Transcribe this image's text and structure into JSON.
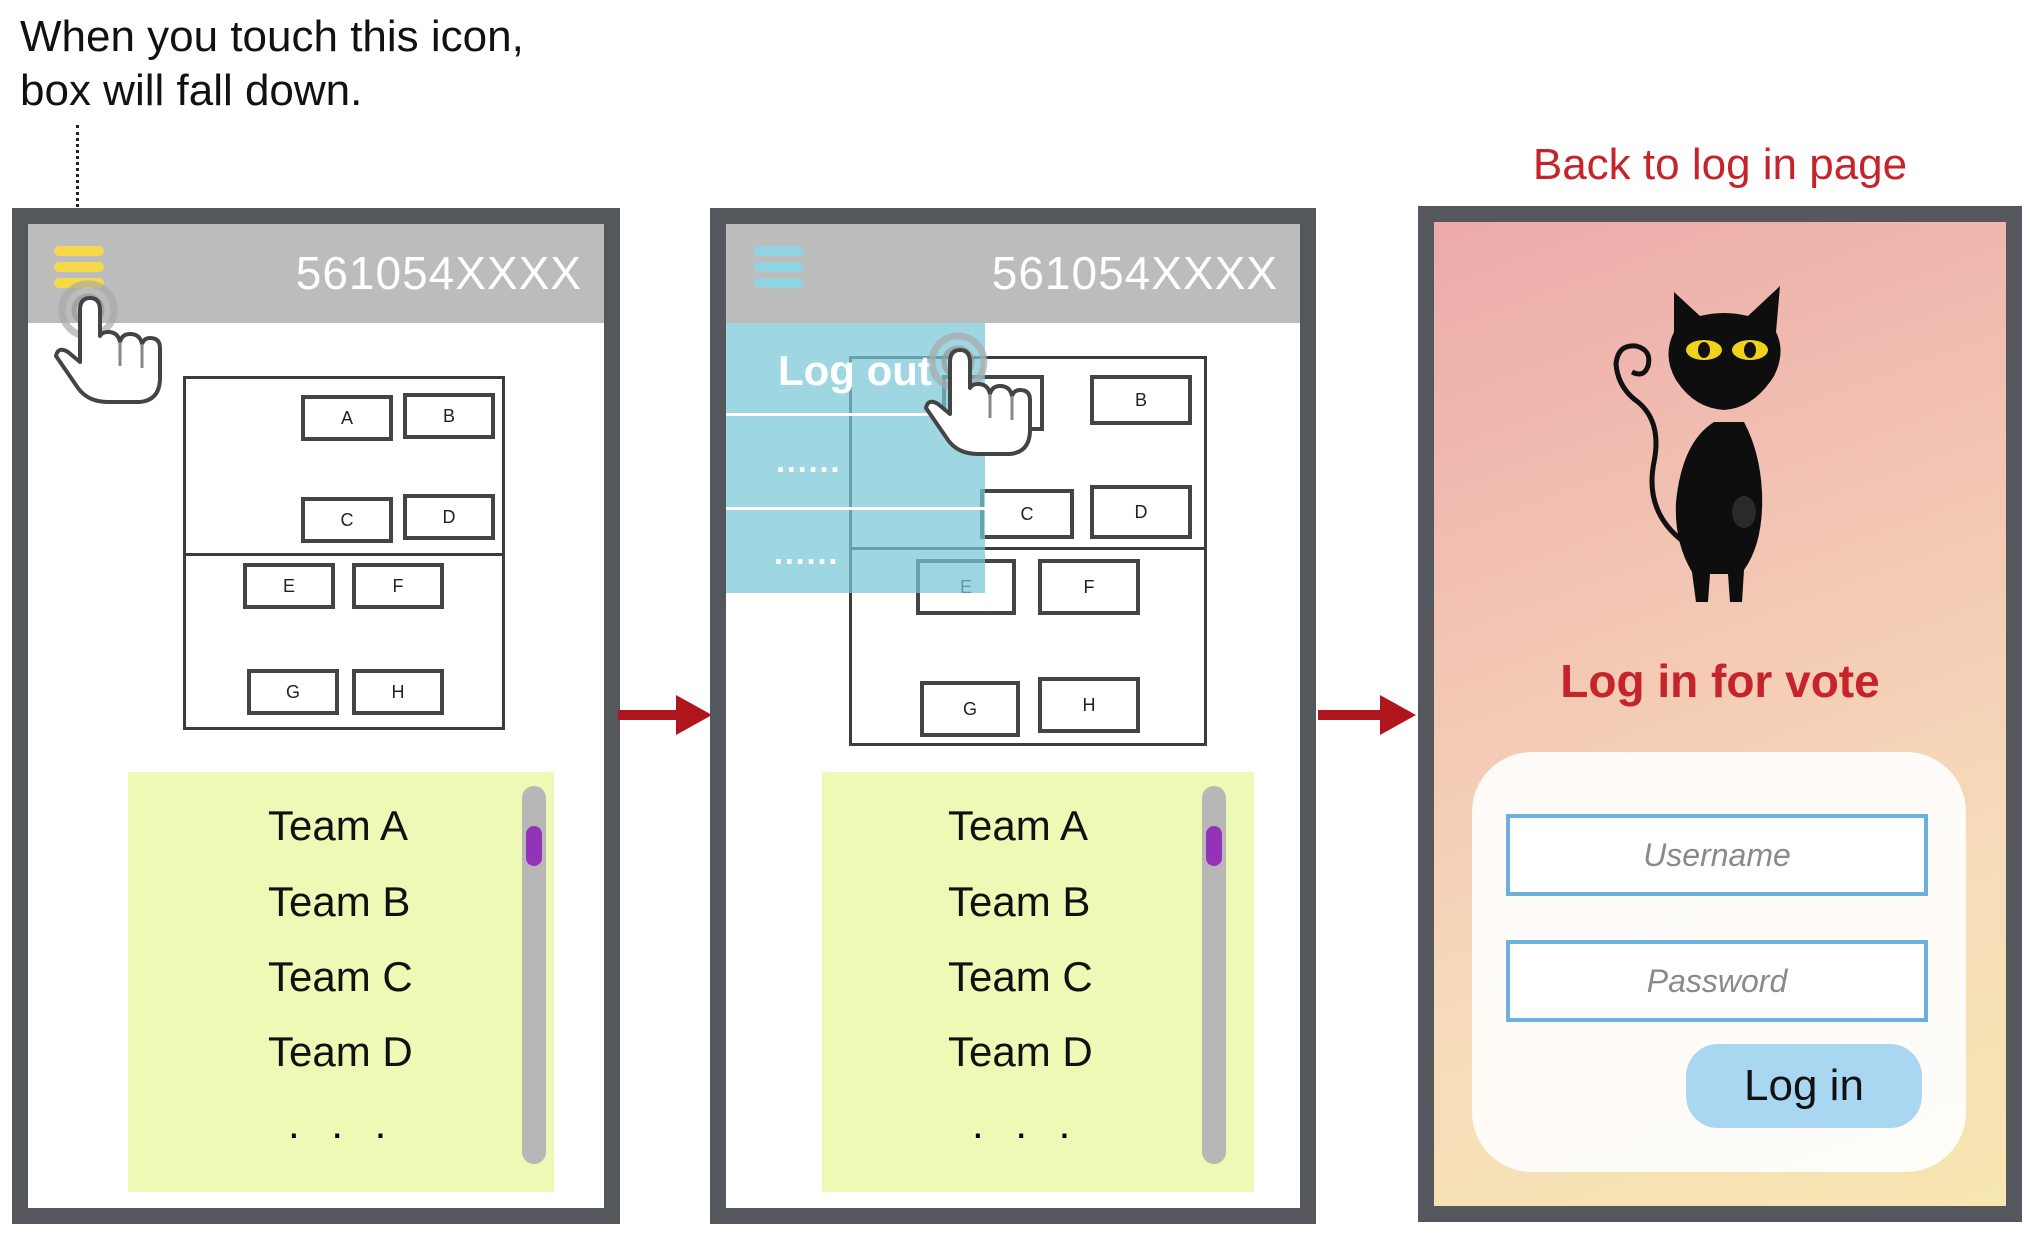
{
  "annotation": {
    "line1": "When you touch this icon,",
    "line2": "box will fall down."
  },
  "login_header": "Back to log in page",
  "screen1": {
    "phone_number": "561054XXXX",
    "menu_icon": "hamburger-menu-icon",
    "seats": [
      "A",
      "B",
      "C",
      "D",
      "E",
      "F",
      "G",
      "H"
    ],
    "teams": [
      "Team A",
      "Team B",
      "Team C",
      "Team D"
    ],
    "more": ". . ."
  },
  "screen2": {
    "phone_number": "561054XXXX",
    "menu_icon": "hamburger-menu-icon",
    "dropdown": {
      "logout": "Log out",
      "item2": "......",
      "item3": "......"
    },
    "seats": [
      "A",
      "B",
      "C",
      "D",
      "E",
      "F",
      "G",
      "H"
    ],
    "teams": [
      "Team A",
      "Team B",
      "Team C",
      "Team D"
    ],
    "more": ". . ."
  },
  "login": {
    "title": "Log in for vote",
    "username_placeholder": "Username",
    "password_placeholder": "Password",
    "button": "Log in"
  },
  "colors": {
    "frame": "#54575c",
    "topbar": "#bcbcbc",
    "menu_yellow": "#f5d94a",
    "menu_blue": "#8fd4e0",
    "list_bg": "#edf9b4",
    "scroll_thumb": "#9334b8",
    "dropdown": "#78c8d6",
    "accent_red": "#c5242b",
    "arrow_red": "#b0141c",
    "input_border": "#6cb0dd",
    "login_button": "#a9d7f1"
  }
}
